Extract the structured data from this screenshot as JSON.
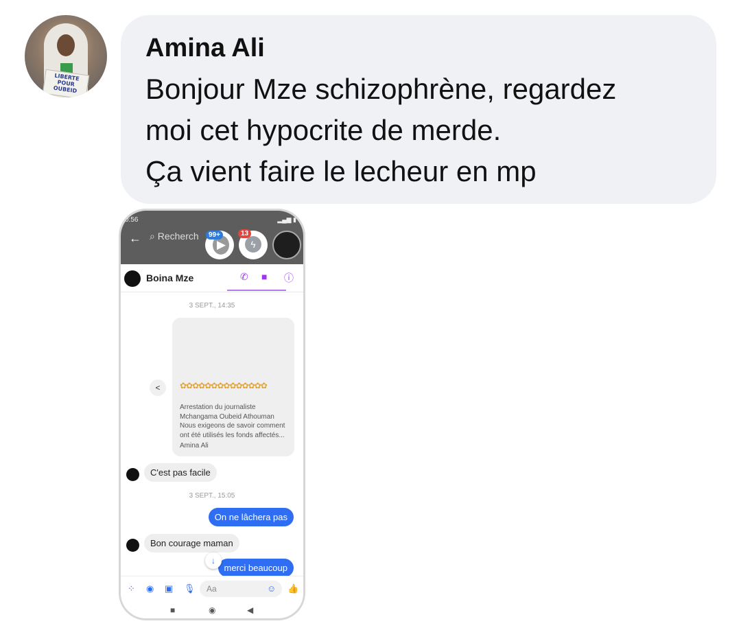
{
  "comment": {
    "author": "Amina Ali",
    "text": "Bonjour Mze schizophrène, regardez\nmoi cet hypocrite de merde.\nÇa vient faire le lecheur en mp",
    "avatar_sign_text": "LIBERTE POUR OUBEID"
  },
  "screenshot": {
    "status_time": "0:56",
    "search_placeholder": "Recherch",
    "badge_play": "99+",
    "badge_messenger": "13",
    "contact_name": "Boina Mze",
    "timestamp_1": "3 SEPT., 14:35",
    "card_stars": "✿✿✿✿✿✿✿✿✿✿✿✿✿✿",
    "card_desc": "Arrestation du journaliste\nMchangama Oubeid Athouman\nNous exigeons de savoir comment\nont été utilisés les fonds affectés...",
    "card_source": "Amina Ali",
    "msg_in_1": "C'est pas facile",
    "timestamp_2": "3 SEPT., 15:05",
    "msg_out_1": "On ne lâchera pas",
    "msg_in_2": "Bon courage maman",
    "msg_out_2": "merci beaucoup",
    "composer_placeholder": "Aa"
  },
  "colors": {
    "bubble_bg": "#eff1f5",
    "messenger_blue": "#2f6ef2",
    "header_icon_purple": "#a035f0"
  },
  "icons": [
    "back-arrow-icon",
    "search-icon",
    "play-icon",
    "messenger-icon",
    "phone-icon",
    "video-icon",
    "info-icon",
    "share-icon",
    "scroll-down-icon",
    "apps-icon",
    "camera-icon",
    "gallery-icon",
    "mic-icon",
    "emoji-icon",
    "thumbs-up-icon",
    "nav-square-icon",
    "nav-home-icon",
    "nav-back-icon"
  ]
}
